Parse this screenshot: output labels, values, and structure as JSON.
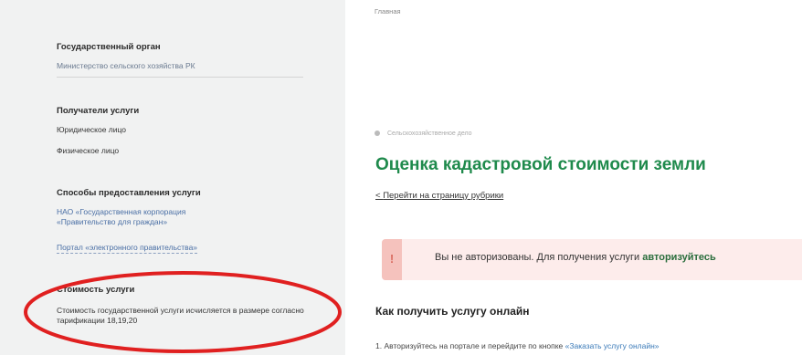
{
  "sidebar": {
    "gov_body_title": "Государственный орган",
    "gov_body_value": "Министерство сельского хозяйства РК",
    "recipients_title": "Получатели услуги",
    "recipients": [
      "Юридическое лицо",
      "Физическое лицо"
    ],
    "methods_title": "Способы предоставления услуги",
    "methods": [
      "НАО «Государственная корпорация «Правительство для граждан»",
      "Портал «электронного правительства»"
    ],
    "cost_title": "Стоимость услуги",
    "cost_text": "Стоимость государственной услуги исчисляется в размере согласно тарификации 18,19,20"
  },
  "main": {
    "top_crumb": "Главная",
    "breadcrumb": "Сельскохозяйственное дело",
    "title": "Оценка кадастровой стоимости земли",
    "back_link": "Перейти на страницу рубрики",
    "alert_text": "Вы не авторизованы. Для получения услуги ",
    "alert_link": "авторизуйтесь",
    "how_title": "Как получить услугу онлайн",
    "step_number": "1.",
    "step_text": "Авторизуйтесь на портале и перейдите по кнопке ",
    "step_link": "«Заказать услугу онлайн»"
  },
  "colors": {
    "accent": "#1f8a4c",
    "annotation": "#e02020",
    "alert_bg": "#fdeceb"
  }
}
